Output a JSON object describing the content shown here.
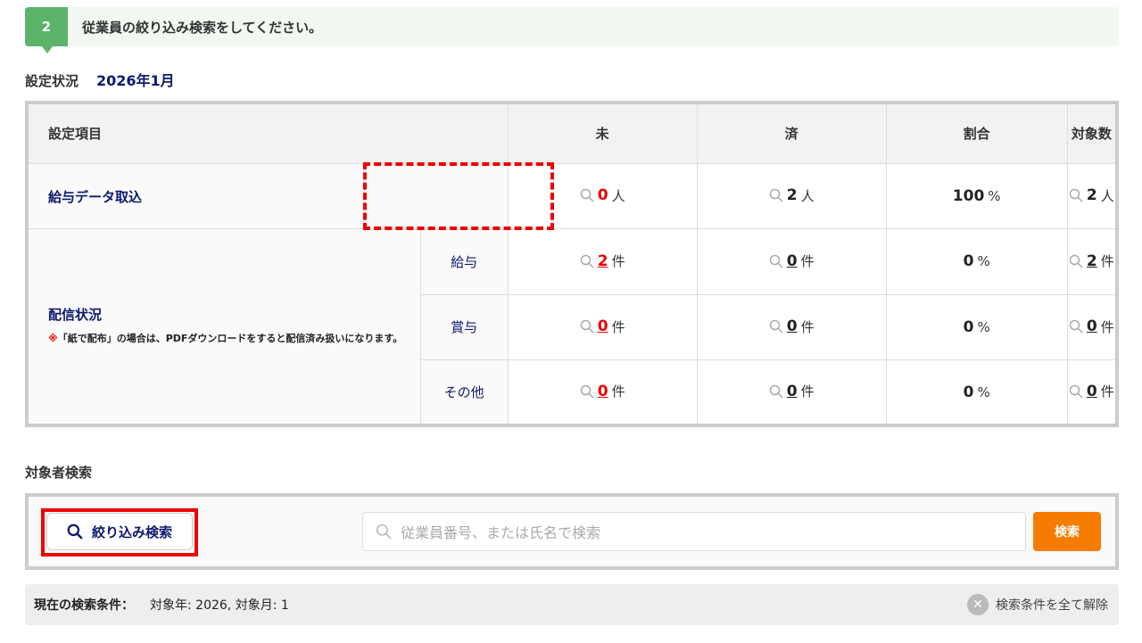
{
  "step": {
    "number": "2",
    "text": "従業員の絞り込み検索をしてください。"
  },
  "status": {
    "label": "設定状況",
    "period": "2026年1月"
  },
  "table": {
    "headers": [
      "設定項目",
      "未",
      "済",
      "割合",
      "対象数"
    ],
    "payroll": {
      "label": "給与データ取込",
      "pending": "0",
      "pending_unit": "人",
      "done": "2",
      "done_unit": "人",
      "ratio": "100",
      "ratio_unit": "%",
      "total": "2",
      "total_unit": "人"
    },
    "delivery": {
      "label": "配信状況",
      "note_mark": "※",
      "note": "「紙で配布」の場合は、PDFダウンロードをすると配信済み扱いになります。",
      "rows": [
        {
          "label": "給与",
          "pending": "2",
          "done": "0",
          "ratio": "0",
          "total": "2",
          "unit": "件",
          "ratio_unit": "%"
        },
        {
          "label": "賞与",
          "pending": "0",
          "done": "0",
          "ratio": "0",
          "total": "0",
          "unit": "件",
          "ratio_unit": "%"
        },
        {
          "label": "その他",
          "pending": "0",
          "done": "0",
          "ratio": "0",
          "total": "0",
          "unit": "件",
          "ratio_unit": "%"
        }
      ]
    }
  },
  "search": {
    "label": "対象者検索",
    "filter_button": "絞り込み検索",
    "placeholder": "従業員番号、または氏名で検索",
    "search_button": "検索"
  },
  "conditions": {
    "label": "現在の検索条件：",
    "value": "対象年: 2026, 対象月: 1",
    "clear": "検索条件を全て解除"
  }
}
